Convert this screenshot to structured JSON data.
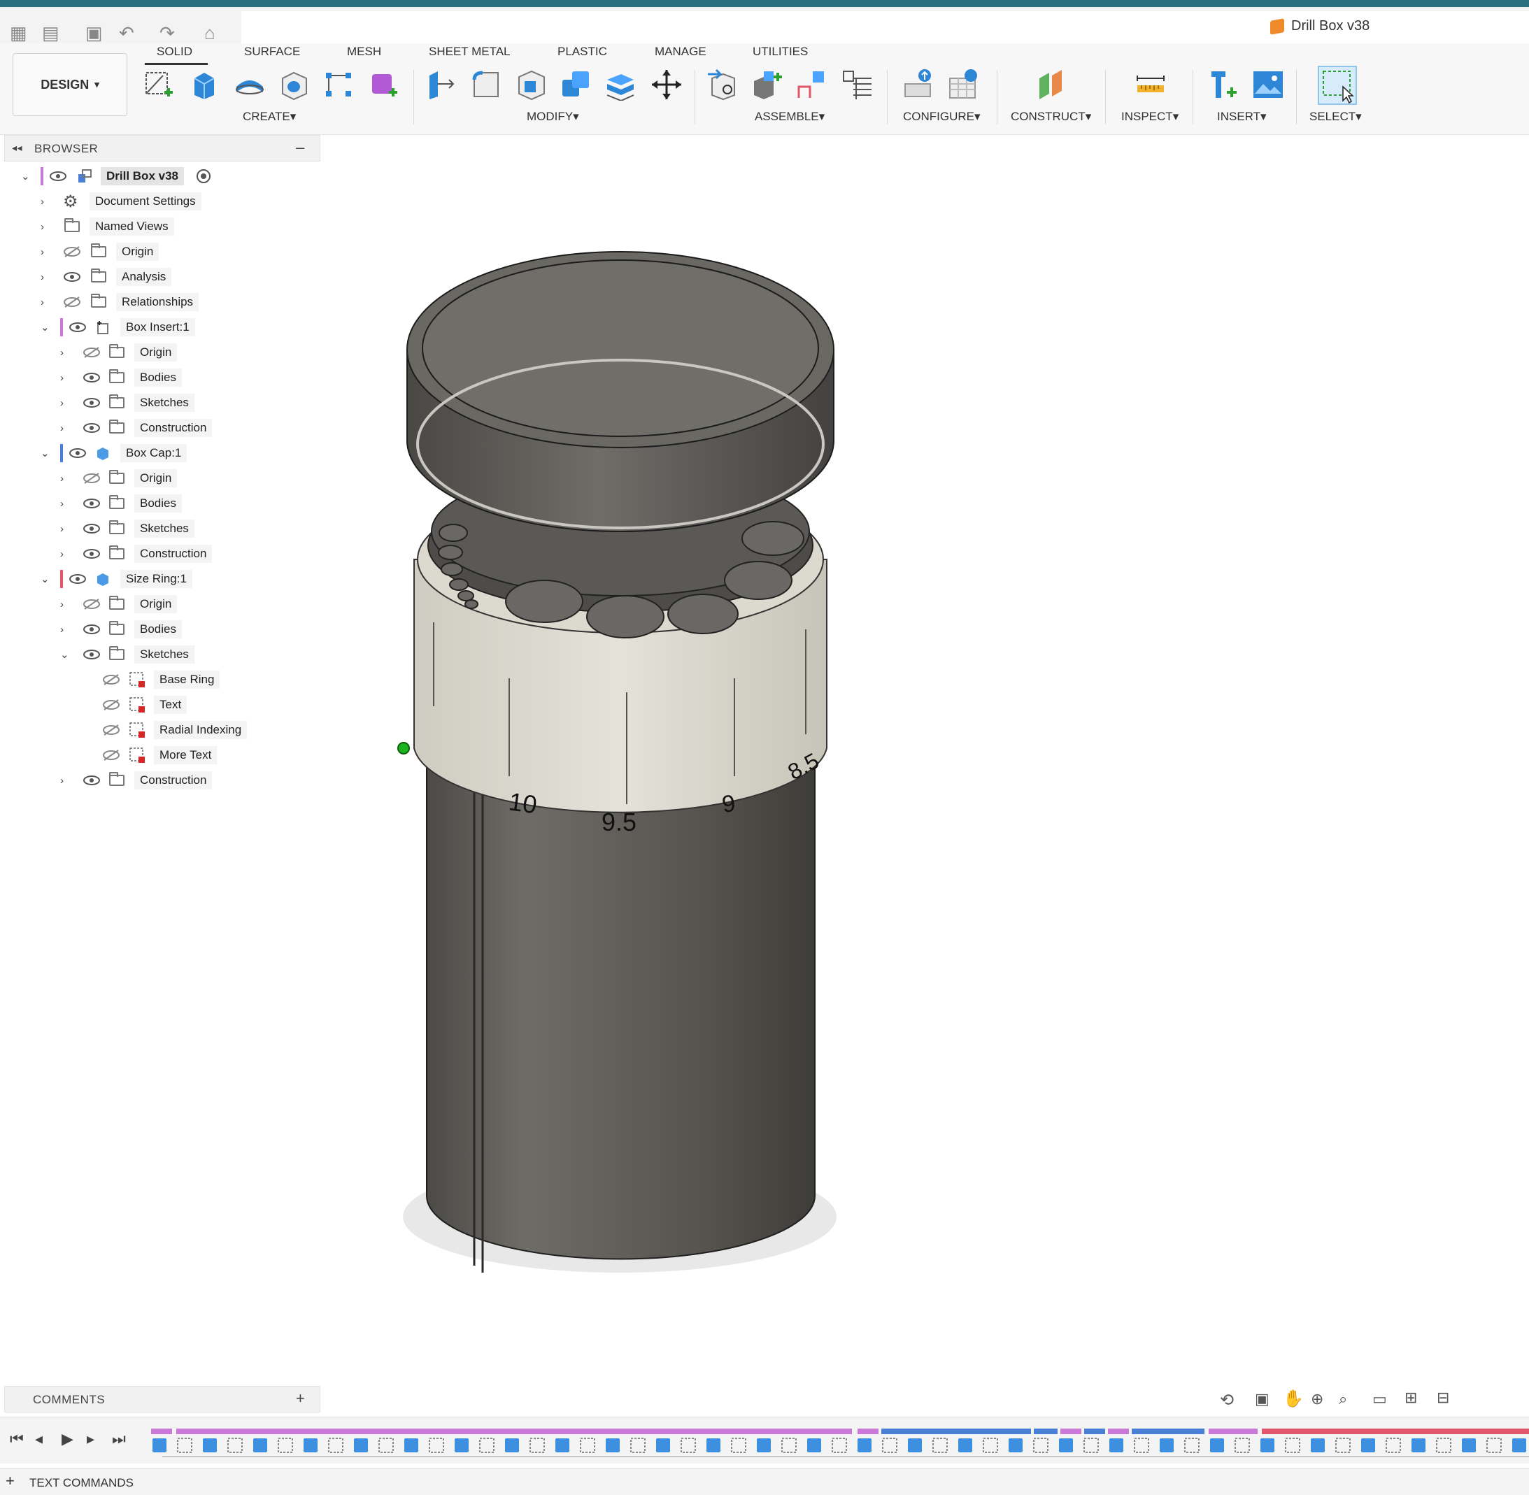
{
  "window": {
    "document_title": "Drill Box v38"
  },
  "toolbar": {
    "workspace": "DESIGN",
    "tabs": [
      "SOLID",
      "SURFACE",
      "MESH",
      "SHEET METAL",
      "PLASTIC",
      "MANAGE",
      "UTILITIES"
    ],
    "groups": [
      "CREATE",
      "MODIFY",
      "ASSEMBLE",
      "CONFIGURE",
      "CONSTRUCT",
      "INSPECT",
      "INSERT",
      "SELECT"
    ],
    "dropdown_glyph": "▾"
  },
  "browser": {
    "title": "BROWSER",
    "root": "Drill Box v38",
    "items": [
      "Document Settings",
      "Named Views",
      "Origin",
      "Analysis",
      "Relationships",
      "Box Insert:1",
      "Origin",
      "Bodies",
      "Sketches",
      "Construction",
      "Box Cap:1",
      "Origin",
      "Bodies",
      "Sketches",
      "Construction",
      "Size Ring:1",
      "Origin",
      "Bodies",
      "Sketches",
      "Base Ring",
      "Text",
      "Radial Indexing",
      "More Text",
      "Construction"
    ]
  },
  "viewport": {
    "ring_labels": [
      "10",
      "9.5",
      "9",
      "8.5"
    ]
  },
  "comments": {
    "title": "COMMENTS",
    "add": "+"
  },
  "text_commands": {
    "title": "TEXT COMMANDS",
    "add": "+"
  },
  "colors": {
    "accent_teal": "#2a6f7f",
    "box_insert": "#c97ad6",
    "box_cap": "#4a7fd6",
    "size_ring": "#e0566a",
    "body_dark": "#5a5752",
    "ring_cream": "#dedbd0"
  }
}
